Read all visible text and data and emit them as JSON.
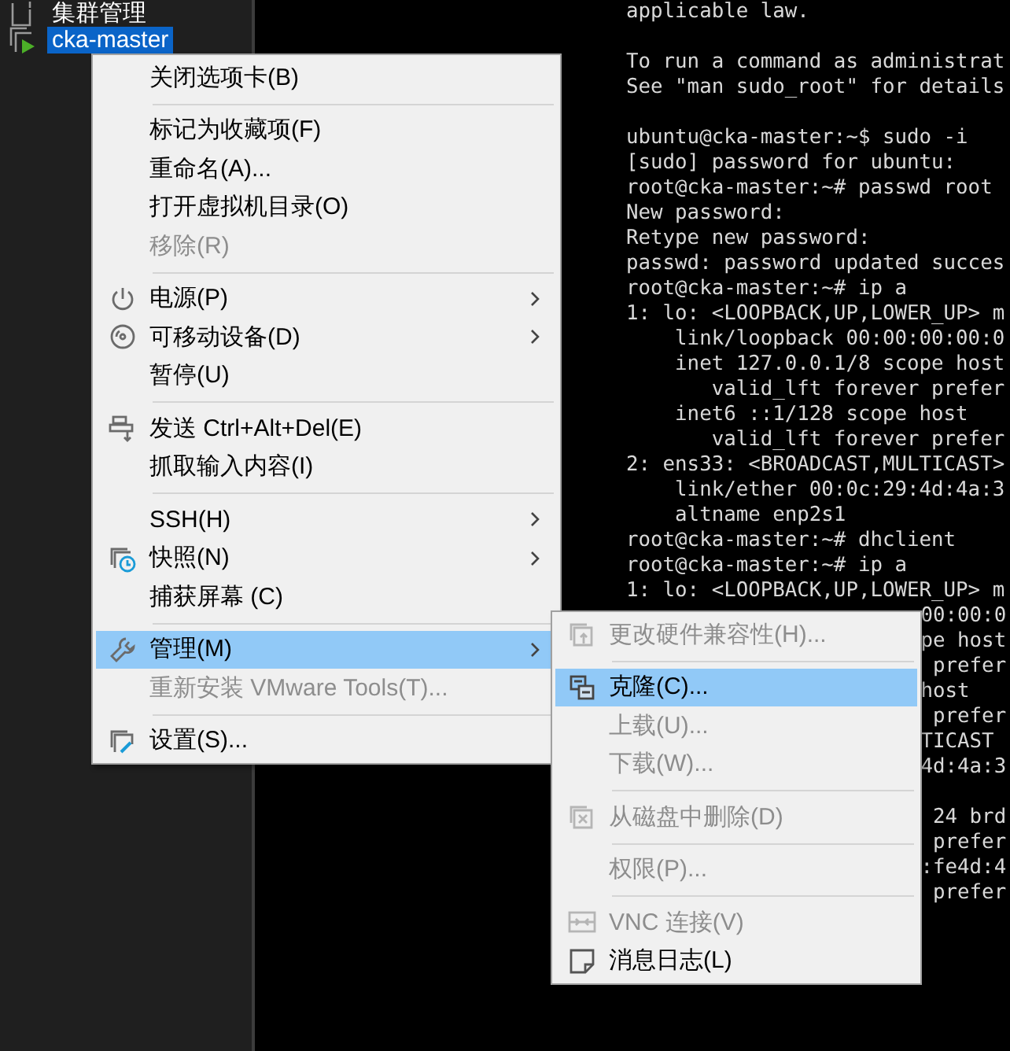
{
  "sidebar": {
    "items": [
      {
        "label": "集群管理",
        "selected": false
      },
      {
        "label": "cka-master",
        "selected": true
      }
    ]
  },
  "terminal": {
    "lines": [
      {
        "kind": "full",
        "text": "applicable law."
      },
      {
        "kind": "blank"
      },
      {
        "kind": "full",
        "text": "To run a command as administrat"
      },
      {
        "kind": "full",
        "text": "See \"man sudo_root\" for details"
      },
      {
        "kind": "blank"
      },
      {
        "kind": "full",
        "text": "ubuntu@cka-master:~$ sudo -i"
      },
      {
        "kind": "full",
        "text": "[sudo] password for ubuntu:"
      },
      {
        "kind": "full",
        "text": "root@cka-master:~# passwd root"
      },
      {
        "kind": "full",
        "text": "New password:"
      },
      {
        "kind": "full",
        "text": "Retype new password:"
      },
      {
        "kind": "full",
        "text": "passwd: password updated succes"
      },
      {
        "kind": "full",
        "text": "root@cka-master:~# ip a"
      },
      {
        "kind": "full",
        "text": "1: lo: <LOOPBACK,UP,LOWER_UP> m"
      },
      {
        "kind": "full",
        "text": "    link/loopback 00:00:00:00:0"
      },
      {
        "kind": "full",
        "text": "    inet 127.0.0.1/8 scope host"
      },
      {
        "kind": "full",
        "text": "       valid_lft forever prefer"
      },
      {
        "kind": "full",
        "text": "    inet6 ::1/128 scope host"
      },
      {
        "kind": "full",
        "text": "       valid_lft forever prefer"
      },
      {
        "kind": "full",
        "text": "2: ens33: <BROADCAST,MULTICAST>"
      },
      {
        "kind": "full",
        "text": "    link/ether 00:0c:29:4d:4a:3"
      },
      {
        "kind": "full",
        "text": "    altname enp2s1"
      },
      {
        "kind": "full",
        "text": "root@cka-master:~# dhclient"
      },
      {
        "kind": "full",
        "text": "root@cka-master:~# ip a"
      },
      {
        "kind": "full",
        "text": "1: lo: <LOOPBACK,UP,LOWER_UP> m"
      },
      {
        "kind": "fragment",
        "text": "00:00:0"
      },
      {
        "kind": "fragment",
        "text": "pe host"
      },
      {
        "kind": "fragment",
        "text": " prefer"
      },
      {
        "kind": "fragment",
        "text": "host"
      },
      {
        "kind": "fragment",
        "text": " prefer"
      },
      {
        "kind": "fragment",
        "text": "TICAST"
      },
      {
        "kind": "fragment",
        "text": "4d:4a:3"
      },
      {
        "kind": "blank"
      },
      {
        "kind": "fragment",
        "text": " 24 brd"
      },
      {
        "kind": "fragment",
        "text": " prefer"
      },
      {
        "kind": "fragment",
        "text": ":fe4d:4"
      },
      {
        "kind": "fragment",
        "text": " prefer"
      }
    ]
  },
  "context_menu": {
    "items": [
      {
        "kind": "item",
        "label": "关闭选项卡(B)",
        "disabled": false,
        "selected": false,
        "submenu": false
      },
      {
        "kind": "separator"
      },
      {
        "kind": "item",
        "label": "标记为收藏项(F)",
        "disabled": false,
        "selected": false,
        "submenu": false
      },
      {
        "kind": "item",
        "label": "重命名(A)...",
        "disabled": false,
        "selected": false,
        "submenu": false
      },
      {
        "kind": "item",
        "label": "打开虚拟机目录(O)",
        "disabled": false,
        "selected": false,
        "submenu": false
      },
      {
        "kind": "item",
        "label": "移除(R)",
        "disabled": true,
        "selected": false,
        "submenu": false
      },
      {
        "kind": "separator"
      },
      {
        "kind": "item",
        "label": "电源(P)",
        "disabled": false,
        "selected": false,
        "submenu": true
      },
      {
        "kind": "item",
        "label": "可移动设备(D)",
        "disabled": false,
        "selected": false,
        "submenu": true
      },
      {
        "kind": "item",
        "label": "暂停(U)",
        "disabled": false,
        "selected": false,
        "submenu": false
      },
      {
        "kind": "separator"
      },
      {
        "kind": "item",
        "label": "发送 Ctrl+Alt+Del(E)",
        "disabled": false,
        "selected": false,
        "submenu": false
      },
      {
        "kind": "item",
        "label": "抓取输入内容(I)",
        "disabled": false,
        "selected": false,
        "submenu": false
      },
      {
        "kind": "separator"
      },
      {
        "kind": "item",
        "label": "SSH(H)",
        "disabled": false,
        "selected": false,
        "submenu": true
      },
      {
        "kind": "item",
        "label": "快照(N)",
        "disabled": false,
        "selected": false,
        "submenu": true
      },
      {
        "kind": "item",
        "label": "捕获屏幕 (C)",
        "disabled": false,
        "selected": false,
        "submenu": false
      },
      {
        "kind": "separator"
      },
      {
        "kind": "item",
        "label": "管理(M)",
        "disabled": false,
        "selected": true,
        "submenu": true
      },
      {
        "kind": "item",
        "label": "重新安装 VMware Tools(T)...",
        "disabled": true,
        "selected": false,
        "submenu": false
      },
      {
        "kind": "separator"
      },
      {
        "kind": "item",
        "label": "设置(S)...",
        "disabled": false,
        "selected": false,
        "submenu": false
      }
    ]
  },
  "submenu": {
    "items": [
      {
        "kind": "item",
        "label": "更改硬件兼容性(H)...",
        "disabled": true,
        "selected": false
      },
      {
        "kind": "separator"
      },
      {
        "kind": "item",
        "label": "克隆(C)...",
        "disabled": false,
        "selected": true
      },
      {
        "kind": "item",
        "label": "上载(U)...",
        "disabled": true,
        "selected": false
      },
      {
        "kind": "item",
        "label": "下载(W)...",
        "disabled": true,
        "selected": false
      },
      {
        "kind": "separator"
      },
      {
        "kind": "item",
        "label": "从磁盘中删除(D)",
        "disabled": true,
        "selected": false
      },
      {
        "kind": "separator"
      },
      {
        "kind": "item",
        "label": "权限(P)...",
        "disabled": true,
        "selected": false
      },
      {
        "kind": "separator"
      },
      {
        "kind": "item",
        "label": "VNC 连接(V)",
        "disabled": true,
        "selected": false
      },
      {
        "kind": "item",
        "label": "消息日志(L)",
        "disabled": false,
        "selected": false
      }
    ]
  }
}
